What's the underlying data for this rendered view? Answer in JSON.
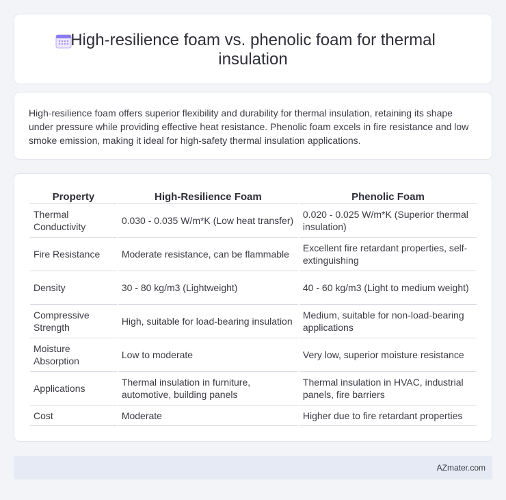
{
  "header": {
    "title": "High-resilience foam vs. phenolic foam for thermal insulation",
    "icon": "calendar-icon",
    "icon_color": "#8c7cf0"
  },
  "intro": {
    "text": "High-resilience foam offers superior flexibility and durability for thermal insulation, retaining its shape under pressure while providing effective heat resistance. Phenolic foam excels in fire resistance and low smoke emission, making it ideal for high-safety thermal insulation applications."
  },
  "table": {
    "headers": [
      "Property",
      "High-Resilience Foam",
      "Phenolic Foam"
    ],
    "rows": [
      [
        "Thermal Conductivity",
        "0.030 - 0.035 W/m*K (Low heat transfer)",
        "0.020 - 0.025 W/m*K (Superior thermal insulation)"
      ],
      [
        "Fire Resistance",
        "Moderate resistance, can be flammable",
        "Excellent fire retardant properties, self-extinguishing"
      ],
      [
        "Density",
        "30 - 80 kg/m3 (Lightweight)",
        "40 - 60 kg/m3 (Light to medium weight)"
      ],
      [
        "Compressive Strength",
        "High, suitable for load-bearing insulation",
        "Medium, suitable for non-load-bearing applications"
      ],
      [
        "Moisture Absorption",
        "Low to moderate",
        "Very low, superior moisture resistance"
      ],
      [
        "Applications",
        "Thermal insulation in furniture, automotive, building panels",
        "Thermal insulation in HVAC, industrial panels, fire barriers"
      ],
      [
        "Cost",
        "Moderate",
        "Higher due to fire retardant properties"
      ]
    ]
  },
  "footer": {
    "brand": "AZmater.com"
  }
}
